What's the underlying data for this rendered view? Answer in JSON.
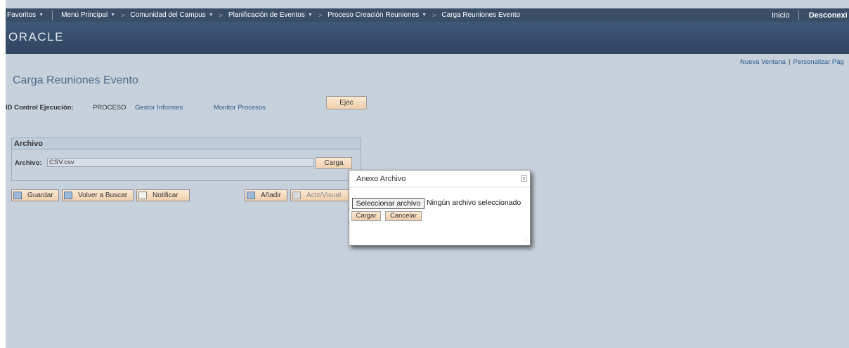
{
  "nav": {
    "items": [
      {
        "label": "Favoritos",
        "dropdown": true
      },
      {
        "label": "Menú Principal",
        "dropdown": true
      },
      {
        "label": "Comunidad del Campus",
        "dropdown": true
      },
      {
        "label": "Planificación de Eventos",
        "dropdown": true
      },
      {
        "label": "Proceso Creación Reuniones",
        "dropdown": true
      },
      {
        "label": "Carga Reuniones Evento",
        "dropdown": false
      }
    ],
    "home": "Inicio",
    "logout": "Desconexi"
  },
  "brand": {
    "logo_text": "ORACLE",
    "bar_color": "#3a4e67",
    "banner_color": "#34495f"
  },
  "links": {
    "new_window": "Nueva Ventana",
    "personalize": "Personalizar Pág"
  },
  "page": {
    "title": "Carga Reuniones Evento"
  },
  "run": {
    "label": "ID Control Ejecución:",
    "value": "PROCESO",
    "report_manager": "Gestor Informes",
    "process_monitor": "Monitor Procesos",
    "run_button": "Ejec"
  },
  "archivo": {
    "header": "Archivo",
    "field_label": "Archivo:",
    "field_value": "CSV.csv",
    "upload_button": "Carga"
  },
  "toolbar": {
    "save": "Guardar",
    "return_to_search": "Volver a Buscar",
    "notify": "Notificar",
    "add": "Añadir",
    "update_display": "Actz/Visual"
  },
  "dialog": {
    "title": "Anexo Archivo",
    "choose_file": "Seleccionar archivo",
    "no_file": "Ningún archivo seleccionado",
    "upload": "Cargar",
    "cancel": "Cancelar"
  },
  "colors": {
    "button_bg": "#f3d8bb",
    "page_bg": "#c7d1dc",
    "link": "#2b5a8a",
    "title": "#4e6b8c"
  }
}
